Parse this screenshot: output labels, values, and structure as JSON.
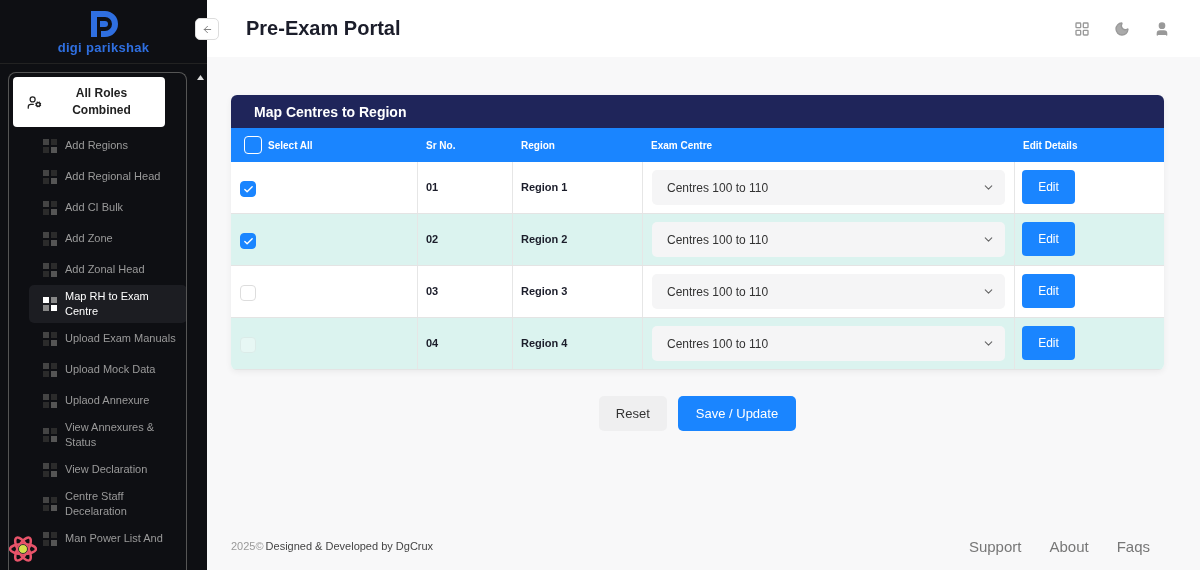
{
  "sidebar": {
    "logo_text": "digi parikshak",
    "role": {
      "label": "All Roles Combined"
    },
    "items": [
      {
        "label": "Add Regions",
        "selected": false
      },
      {
        "label": "Add Regional Head",
        "selected": false
      },
      {
        "label": "Add CI Bulk",
        "selected": false
      },
      {
        "label": "Add Zone",
        "selected": false
      },
      {
        "label": "Add Zonal Head",
        "selected": false
      },
      {
        "label": "Map RH to Exam Centre",
        "selected": true
      },
      {
        "label": "Upload Exam Manuals",
        "selected": false
      },
      {
        "label": "Upload Mock Data",
        "selected": false
      },
      {
        "label": "Uplaod Annexure",
        "selected": false
      },
      {
        "label": "View Annexures & Status",
        "selected": false
      },
      {
        "label": "View Declaration",
        "selected": false
      },
      {
        "label": "Centre Staff Decelaration",
        "selected": false
      },
      {
        "label": "Man Power List And",
        "selected": false
      }
    ]
  },
  "header": {
    "title": "Pre-Exam Portal"
  },
  "card": {
    "title": "Map Centres to Region",
    "select_all": {
      "label": "Select All",
      "checked": false
    },
    "columns": [
      "Sr No.",
      "Region",
      "Exam Centre",
      "Edit Details"
    ],
    "rows": [
      {
        "checked": true,
        "disabled": false,
        "sr": "01",
        "region": "Region 1",
        "centre": "Centres 100 to 110",
        "action": "Edit"
      },
      {
        "checked": true,
        "disabled": false,
        "sr": "02",
        "region": "Region 2",
        "centre": "Centres 100 to 110",
        "action": "Edit"
      },
      {
        "checked": false,
        "disabled": false,
        "sr": "03",
        "region": "Region 3",
        "centre": "Centres 100 to 110",
        "action": "Edit"
      },
      {
        "checked": false,
        "disabled": true,
        "sr": "04",
        "region": "Region 4",
        "centre": "Centres 100 to 110",
        "action": "Edit"
      }
    ]
  },
  "buttons": [
    {
      "label": "Reset",
      "kind": "secondary"
    },
    {
      "label": "Save / Update",
      "kind": "primary"
    }
  ],
  "footer": {
    "year": "2025©",
    "credit": "Designed & Developed by DgCrux",
    "links": [
      "Support",
      "About",
      "Faqs"
    ]
  }
}
